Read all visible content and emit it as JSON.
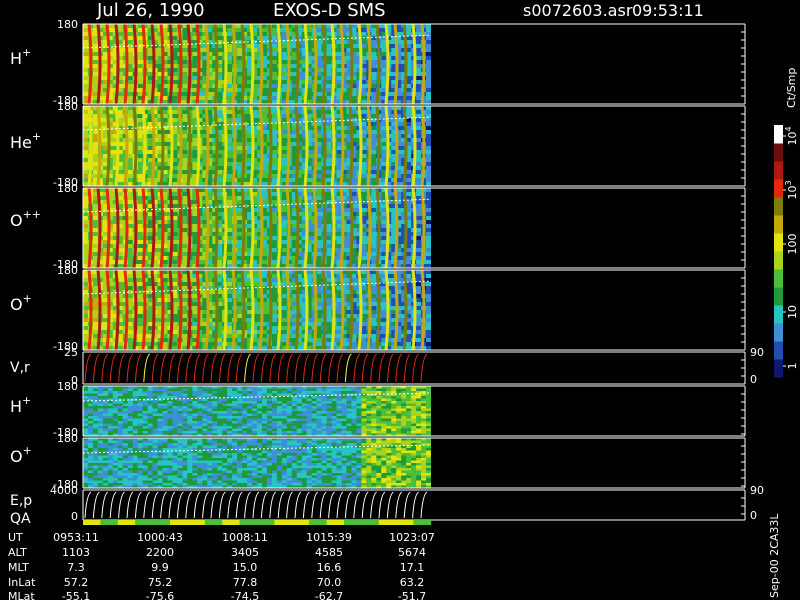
{
  "header": {
    "date": "Jul 26, 1990",
    "mission": "EXOS-D SMS",
    "file": "s0072603.asr",
    "time": "09:53:11"
  },
  "colorbar": {
    "unit_label": "Ct/Smp",
    "tick_labels": [
      "1",
      "10",
      "100",
      "10",
      "10"
    ],
    "tick_exponents": [
      "",
      "",
      "",
      "3",
      "4"
    ],
    "stops": [
      "#0a1a6e",
      "#1e4fb4",
      "#3f8fd6",
      "#27c4c4",
      "#1d9a3c",
      "#4cbf3a",
      "#a9d31d",
      "#e3e310",
      "#c4a80c",
      "#7c7c08",
      "#e02a0a",
      "#aa1a14",
      "#6e0c0c",
      "#ffffff"
    ]
  },
  "footer": {
    "side_label": "Sep-00 2CA33L",
    "row_labels": [
      "UT",
      "ALT",
      "MLT",
      "InLat",
      "MLat"
    ],
    "columns": [
      [
        "0953:11",
        "1103",
        "7.3",
        "57.2",
        "-55.1"
      ],
      [
        "1000:43",
        "2200",
        "9.9",
        "75.2",
        "-75.6"
      ],
      [
        "1008:11",
        "3405",
        "15.0",
        "77.8",
        "-74.5"
      ],
      [
        "1015:39",
        "4585",
        "16.6",
        "70.0",
        "-62.7"
      ],
      [
        "1023:07",
        "5674",
        "17.1",
        "63.2",
        "-51.7"
      ]
    ]
  },
  "chart_data": [
    {
      "type": "heatmap",
      "species": "H",
      "charge": "+",
      "ylim": [
        -180,
        180
      ],
      "tick_top": "180",
      "tick_bottom": "-180"
    },
    {
      "type": "heatmap",
      "species": "He",
      "charge": "+",
      "ylim": [
        -180,
        180
      ],
      "tick_top": "180",
      "tick_bottom": "-180"
    },
    {
      "type": "heatmap",
      "species": "O",
      "charge": "++",
      "ylim": [
        -180,
        180
      ],
      "tick_top": "180",
      "tick_bottom": "-180"
    },
    {
      "type": "heatmap",
      "species": "O",
      "charge": "+",
      "ylim": [
        -180,
        180
      ],
      "tick_top": "180",
      "tick_bottom": "-180"
    },
    {
      "type": "line",
      "label": "V,r",
      "ylim_left": [
        0,
        25
      ],
      "tick_top": "25",
      "tick_bottom": "0",
      "right_top": "90",
      "right_bottom": "0"
    },
    {
      "type": "heatmap",
      "species": "H",
      "charge": "+",
      "ylim": [
        -180,
        180
      ],
      "tick_top": "180",
      "tick_bottom": "-180"
    },
    {
      "type": "heatmap",
      "species": "O",
      "charge": "+",
      "ylim": [
        -180,
        180
      ],
      "tick_top": "180",
      "tick_bottom": "-180"
    },
    {
      "type": "line",
      "label": "E,p",
      "label2": "QA",
      "ylim_left": [
        0,
        4000
      ],
      "tick_top": "4000",
      "tick_bottom": "0",
      "right_top": "90",
      "right_bottom": "0"
    }
  ]
}
